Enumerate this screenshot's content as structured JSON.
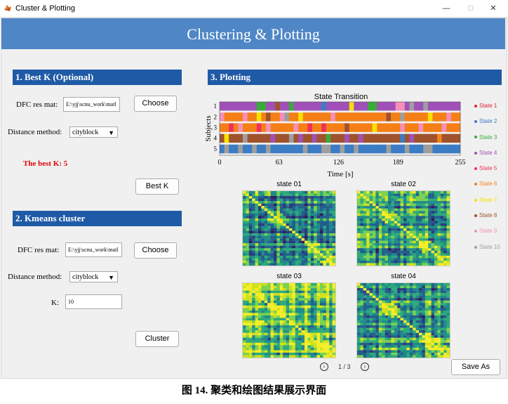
{
  "window": {
    "title": "Cluster & Plotting",
    "minimize": "—",
    "maximize": "□",
    "close": "✕"
  },
  "header": {
    "title": "Clustering & Plotting"
  },
  "best_k_panel": {
    "heading": "1. Best K (Optional)",
    "dfc_label": "DFC res mat:",
    "dfc_value": "E:\\yjj\\scnu_work\\matl",
    "choose_label": "Choose",
    "distance_label": "Distance method:",
    "distance_value": "cityblock",
    "result_text": "The best K:  5",
    "bestk_button": "Best K"
  },
  "kmeans_panel": {
    "heading": "2. Kmeans cluster",
    "dfc_label": "DFC res mat:",
    "dfc_value": "E:\\yjj\\scnu_work\\matl",
    "choose_label": "Choose",
    "distance_label": "Distance method:",
    "distance_value": "cityblock",
    "k_label": "K:",
    "k_value": "10",
    "cluster_button": "Cluster"
  },
  "plotting_panel": {
    "heading": "3. Plotting",
    "save_button": "Save As",
    "page_indicator": "1 / 3",
    "prev_icon": "chevron-left-icon",
    "next_icon": "chevron-right-icon"
  },
  "chart_data": {
    "type": "heatmap",
    "title": "State Transition",
    "xlabel": "Time [s]",
    "ylabel": "Subjects",
    "x_ticks": [
      0,
      63,
      126,
      189,
      255
    ],
    "y_ticks": [
      1,
      2,
      3,
      4,
      5
    ],
    "xlim": [
      0,
      255
    ],
    "legend_position": "right",
    "legend": [
      {
        "name": "State 1",
        "color": "#e02030"
      },
      {
        "name": "State 2",
        "color": "#3b7cc4"
      },
      {
        "name": "State 3",
        "color": "#3aaa3a"
      },
      {
        "name": "State 4",
        "color": "#a050b8"
      },
      {
        "name": "State 5",
        "color": "#f0305a"
      },
      {
        "name": "State 6",
        "color": "#f57f17"
      },
      {
        "name": "State 7",
        "color": "#f5e100"
      },
      {
        "name": "State 8",
        "color": "#a0522d"
      },
      {
        "name": "State 9",
        "color": "#f58fb8"
      },
      {
        "name": "State 10",
        "color": "#9e9e9e"
      }
    ],
    "rows": [
      [
        4,
        4,
        4,
        4,
        4,
        4,
        4,
        4,
        3,
        3,
        4,
        4,
        8,
        4,
        4,
        3,
        4,
        4,
        4,
        4,
        4,
        4,
        2,
        4,
        4,
        4,
        4,
        4,
        7,
        4,
        4,
        4,
        3,
        3,
        4,
        4,
        4,
        4,
        9,
        9,
        4,
        10,
        4,
        4,
        10,
        4,
        4,
        4,
        4,
        4,
        4,
        4
      ],
      [
        9,
        6,
        6,
        6,
        6,
        9,
        6,
        6,
        7,
        6,
        8,
        6,
        6,
        9,
        10,
        6,
        6,
        7,
        6,
        6,
        6,
        6,
        6,
        6,
        9,
        6,
        6,
        6,
        6,
        6,
        6,
        6,
        6,
        6,
        6,
        6,
        8,
        6,
        6,
        10,
        6,
        6,
        6,
        6,
        6,
        7,
        6,
        6,
        6,
        9,
        6,
        6
      ],
      [
        6,
        6,
        5,
        6,
        9,
        6,
        6,
        6,
        5,
        6,
        9,
        6,
        6,
        6,
        6,
        6,
        9,
        6,
        6,
        5,
        6,
        6,
        5,
        6,
        6,
        6,
        6,
        8,
        6,
        6,
        6,
        6,
        6,
        7,
        6,
        6,
        6,
        6,
        6,
        9,
        6,
        6,
        6,
        9,
        6,
        6,
        6,
        6,
        9,
        6,
        6,
        6
      ],
      [
        8,
        7,
        8,
        8,
        8,
        10,
        8,
        8,
        8,
        8,
        8,
        4,
        8,
        8,
        8,
        10,
        8,
        4,
        8,
        8,
        4,
        8,
        8,
        3,
        8,
        8,
        8,
        4,
        8,
        8,
        4,
        8,
        8,
        8,
        8,
        8,
        8,
        8,
        8,
        2,
        8,
        4,
        8,
        8,
        8,
        8,
        8,
        6,
        8,
        8,
        8,
        8
      ],
      [
        2,
        10,
        2,
        2,
        10,
        2,
        2,
        10,
        2,
        2,
        10,
        2,
        2,
        2,
        2,
        2,
        2,
        2,
        10,
        2,
        2,
        2,
        10,
        10,
        2,
        2,
        10,
        2,
        2,
        10,
        2,
        2,
        2,
        2,
        2,
        2,
        10,
        2,
        2,
        2,
        10,
        2,
        2,
        2,
        10,
        10,
        2,
        2,
        2,
        2,
        2,
        2
      ]
    ],
    "matrices": [
      {
        "title": "state 01"
      },
      {
        "title": "state 02"
      },
      {
        "title": "state 03"
      },
      {
        "title": "state 04"
      }
    ]
  }
}
